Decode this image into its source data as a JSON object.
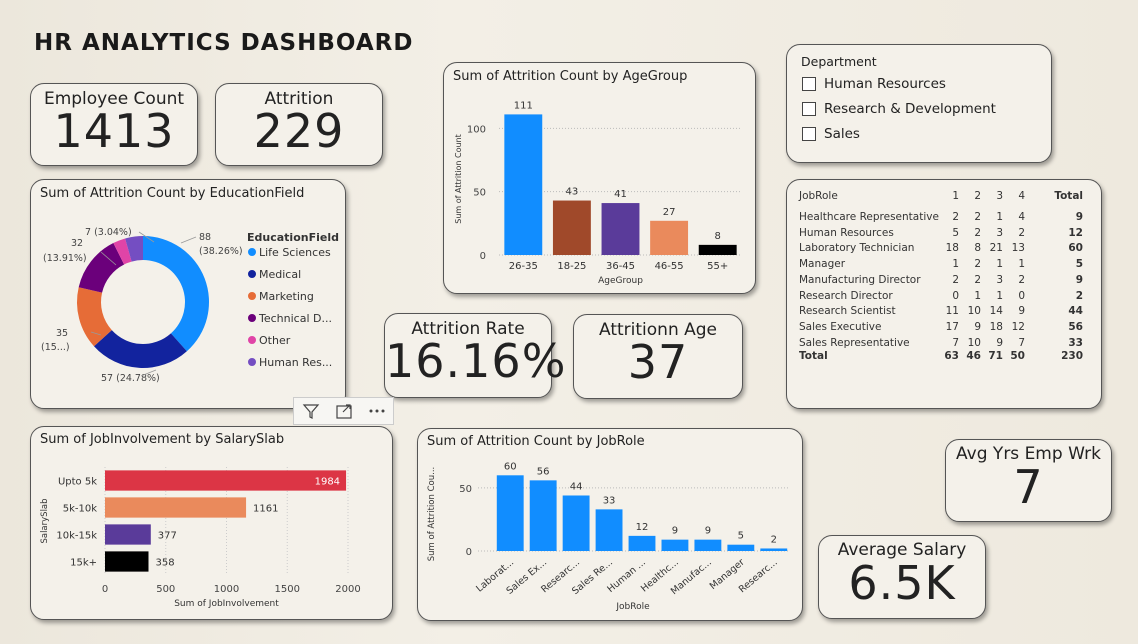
{
  "title": "HR ANALYTICS DASHBOARD",
  "kpis": {
    "employee_count": {
      "label": "Employee Count",
      "value": "1413"
    },
    "attrition": {
      "label": "Attrition",
      "value": "229"
    },
    "attrition_rate": {
      "label": "Attrition Rate",
      "value": "16.16%"
    },
    "attrition_age": {
      "label": "Attritionn Age",
      "value": "37"
    },
    "avg_yrs": {
      "label": "Avg Yrs Emp Wrk",
      "value": "7"
    },
    "avg_salary": {
      "label": "Average Salary",
      "value": "6.5K"
    }
  },
  "slicer": {
    "title": "Department",
    "options": [
      "Human Resources",
      "Research & Development",
      "Sales"
    ]
  },
  "visual_header": {
    "icons": [
      "filter-icon",
      "focus-mode-icon",
      "more-options-icon"
    ]
  },
  "chart_data": [
    {
      "id": "age_group",
      "type": "bar",
      "title": "Sum of Attrition Count by AgeGroup",
      "xlabel": "AgeGroup",
      "ylabel": "Sum of Attrition Count",
      "categories": [
        "26-35",
        "18-25",
        "36-45",
        "46-55",
        "55+"
      ],
      "values": [
        111,
        43,
        41,
        27,
        8
      ],
      "colors": [
        "#118dff",
        "#a0492a",
        "#5a3b9a",
        "#ea8a5c",
        "#000000"
      ],
      "ylim": [
        0,
        120
      ],
      "yticks": [
        0,
        50,
        100
      ],
      "yticklabels": [
        "0",
        "50",
        "100"
      ]
    },
    {
      "id": "education_field",
      "type": "pie",
      "title": "Sum of Attrition Count by EducationField",
      "legend_title": "EducationField",
      "labels": [
        "Life Sciences",
        "Medical",
        "Marketing",
        "Technical D...",
        "Other",
        "Human Res..."
      ],
      "values": [
        88,
        57,
        35,
        32,
        7,
        10
      ],
      "colors": [
        "#118dff",
        "#12239e",
        "#e66c37",
        "#6b007b",
        "#e044a7",
        "#744ec2"
      ],
      "data_labels": [
        "88",
        "(38.26%)",
        "57 (24.78%)",
        "35",
        "(15...)",
        "32",
        "(13.91%)",
        "7 (3.04%)"
      ]
    },
    {
      "id": "salary_slab",
      "type": "bar",
      "orientation": "horizontal",
      "title": "Sum of JobInvolvement by SalarySlab",
      "xlabel": "Sum of JobInvolvement",
      "ylabel": "SalarySlab",
      "categories": [
        "Upto 5k",
        "5k-10k",
        "10k-15k",
        "15k+"
      ],
      "values": [
        1984,
        1161,
        377,
        358
      ],
      "colors": [
        "#dc3545",
        "#ea8a5c",
        "#5a3b9a",
        "#000000"
      ],
      "xlim": [
        0,
        2000
      ],
      "xticks": [
        0,
        500,
        1000,
        1500,
        2000
      ],
      "xticklabels": [
        "0",
        "500",
        "1000",
        "1500",
        "2000"
      ]
    },
    {
      "id": "job_role",
      "type": "bar",
      "title": "Sum of Attrition Count by JobRole",
      "xlabel": "JobRole",
      "ylabel": "Sum of Attrition Cou...",
      "categories": [
        "Laborat...",
        "Sales Ex...",
        "Researc...",
        "Sales Re...",
        "Human ...",
        "Healthc...",
        "Manufac...",
        "Manager",
        "Researc..."
      ],
      "values": [
        60,
        56,
        44,
        33,
        12,
        9,
        9,
        5,
        2
      ],
      "color": "#118dff",
      "ylim": [
        0,
        65
      ],
      "yticks": [
        0,
        50
      ],
      "yticklabels": [
        "0",
        "50"
      ]
    },
    {
      "id": "job_role_matrix",
      "type": "table",
      "columns": [
        "JobRole",
        "1",
        "2",
        "3",
        "4",
        "Total"
      ],
      "rows": [
        [
          "Healthcare Representative",
          "2",
          "2",
          "1",
          "4",
          "9"
        ],
        [
          "Human Resources",
          "5",
          "2",
          "3",
          "2",
          "12"
        ],
        [
          "Laboratory Technician",
          "18",
          "8",
          "21",
          "13",
          "60"
        ],
        [
          "Manager",
          "1",
          "2",
          "1",
          "1",
          "5"
        ],
        [
          "Manufacturing Director",
          "2",
          "2",
          "3",
          "2",
          "9"
        ],
        [
          "Research Director",
          "0",
          "1",
          "1",
          "0",
          "2"
        ],
        [
          "Research Scientist",
          "11",
          "10",
          "14",
          "9",
          "44"
        ],
        [
          "Sales Executive",
          "17",
          "9",
          "18",
          "12",
          "56"
        ],
        [
          "Sales Representative",
          "7",
          "10",
          "9",
          "7",
          "33"
        ]
      ],
      "total_row": [
        "Total",
        "63",
        "46",
        "71",
        "50",
        "230"
      ]
    }
  ]
}
